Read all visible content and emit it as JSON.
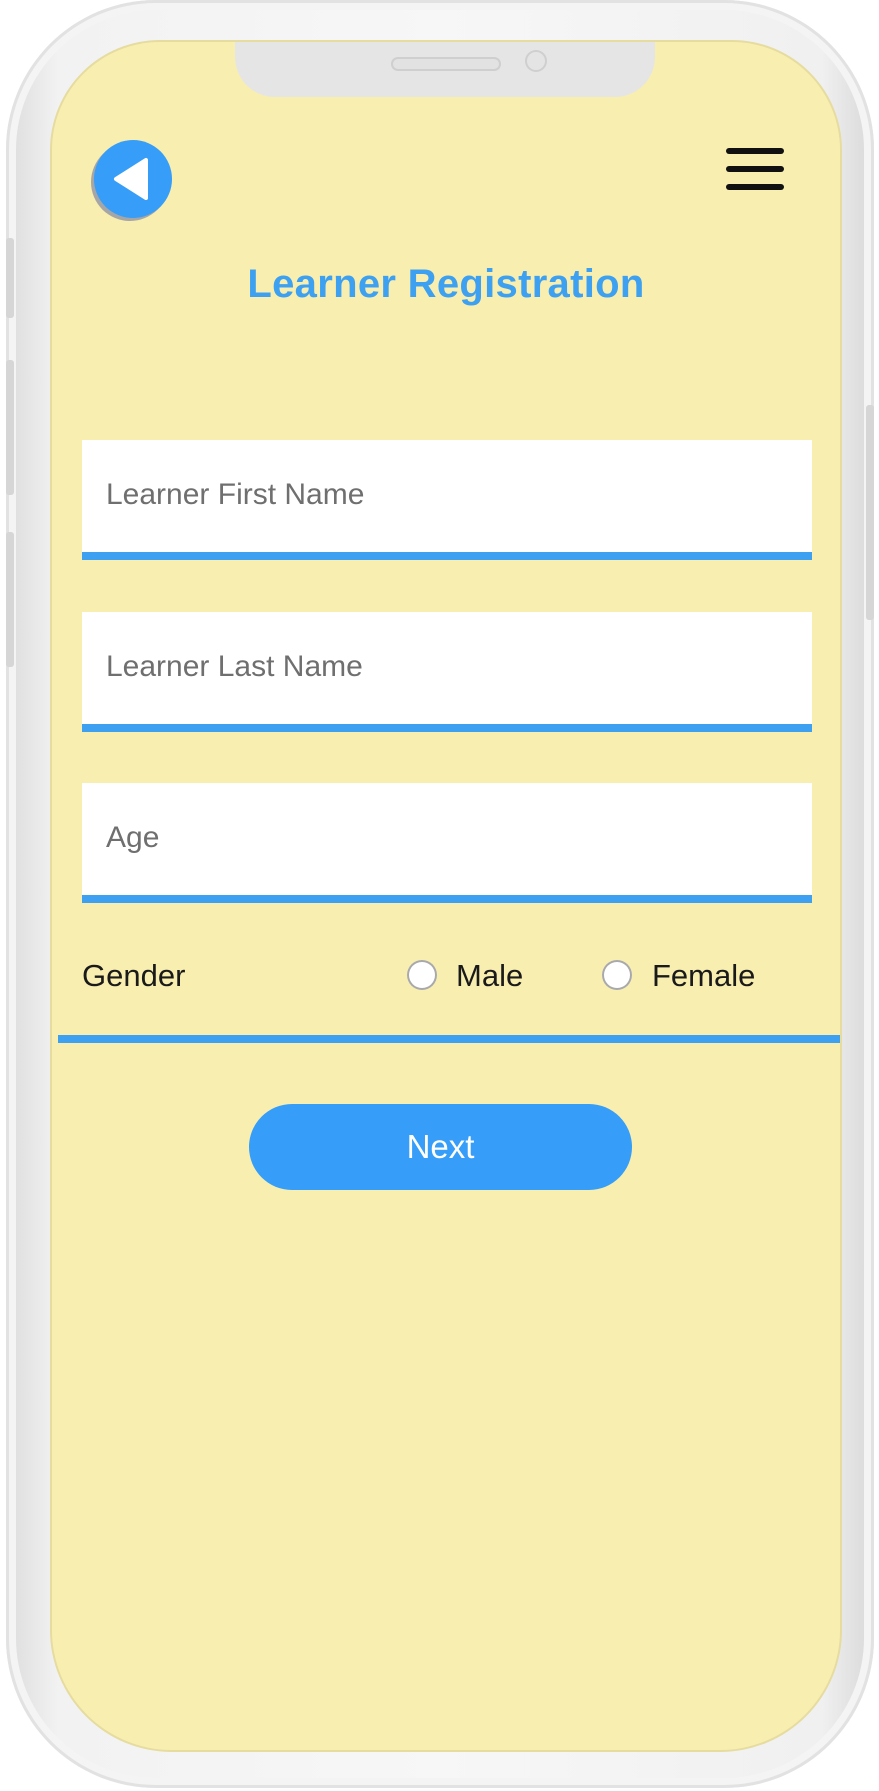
{
  "header": {
    "title": "Learner Registration",
    "back_icon": "back-arrow-icon",
    "menu_icon": "hamburger-menu-icon"
  },
  "form": {
    "first_name": {
      "placeholder": "Learner First Name",
      "value": ""
    },
    "last_name": {
      "placeholder": "Learner Last Name",
      "value": ""
    },
    "age": {
      "placeholder": "Age",
      "value": ""
    },
    "gender": {
      "label": "Gender",
      "options": [
        "Male",
        "Female"
      ],
      "selected": ""
    },
    "next_label": "Next"
  },
  "colors": {
    "screen_background": "#f8eeb0",
    "accent": "#3ea0f0",
    "button": "#369df8"
  }
}
